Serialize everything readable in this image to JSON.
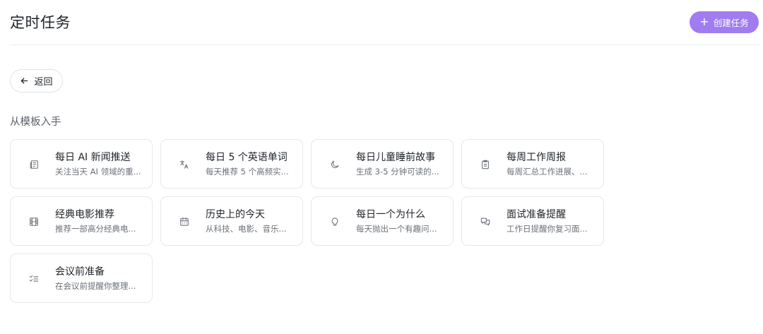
{
  "header": {
    "title": "定时任务",
    "create_button": {
      "icon": "+",
      "label": "创建任务"
    }
  },
  "back_button": {
    "label": "返回"
  },
  "section": {
    "title": "从模板入手"
  },
  "templates": [
    {
      "icon": "newspaper-icon",
      "title": "每日 AI 新闻推送",
      "desc": "关注当天 AI 领域的重..."
    },
    {
      "icon": "translate-icon",
      "title": "每日 5 个英语单词",
      "desc": "每天推荐 5 个高频实..."
    },
    {
      "icon": "moon-icon",
      "title": "每日儿童睡前故事",
      "desc": "生成 3-5 分钟可读的..."
    },
    {
      "icon": "clipboard-icon",
      "title": "每周工作周报",
      "desc": "每周汇总工作进展、..."
    },
    {
      "icon": "film-icon",
      "title": "经典电影推荐",
      "desc": "推荐一部高分经典电..."
    },
    {
      "icon": "calendar-icon",
      "title": "历史上的今天",
      "desc": "从科技、电影、音乐..."
    },
    {
      "icon": "lightbulb-icon",
      "title": "每日一个为什么",
      "desc": "每天抛出一个有趣问..."
    },
    {
      "icon": "chat-bubbles-icon",
      "title": "面试准备提醒",
      "desc": "工作日提醒你复习面..."
    },
    {
      "icon": "checklist-icon",
      "title": "会议前准备",
      "desc": "在会议前提醒你整理..."
    }
  ],
  "colors": {
    "accent": "#a07cf0",
    "text_primary": "#1f2329",
    "text_secondary": "#6b7078",
    "border": "#e6e8eb"
  }
}
